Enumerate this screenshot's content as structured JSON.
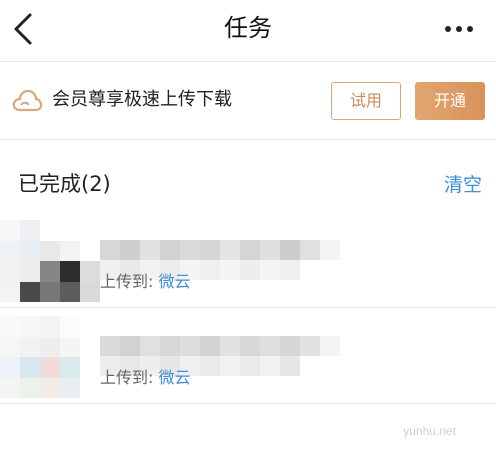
{
  "header": {
    "title": "任务"
  },
  "vip_banner": {
    "text": "会员尊享极速上传下载",
    "try_label": "试用",
    "open_label": "开通",
    "accent": "#d9a77a"
  },
  "section": {
    "title": "已完成(2)",
    "clear_label": "清空"
  },
  "tasks": [
    {
      "dest_label": "上传到:",
      "dest_value": "微云"
    },
    {
      "dest_label": "上传到:",
      "dest_value": "微云"
    }
  ],
  "watermark": "yunhu.net",
  "colors": {
    "link": "#3d8ed8",
    "divider": "#e6e6e6"
  }
}
